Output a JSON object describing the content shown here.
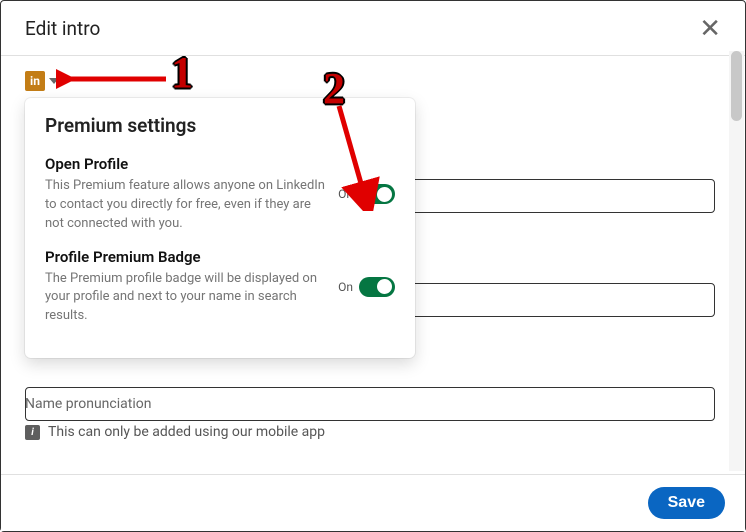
{
  "header": {
    "title": "Edit intro"
  },
  "badge": {
    "logo_text": "in"
  },
  "panel": {
    "title": "Premium settings",
    "settings": [
      {
        "title": "Open Profile",
        "desc": "This Premium feature allows anyone on LinkedIn to contact you directly for free, even if they are not connected with you.",
        "state": "On"
      },
      {
        "title": "Profile Premium Badge",
        "desc": "The Premium profile badge will be displayed on your profile and next to your name in search results.",
        "state": "On"
      }
    ]
  },
  "name_section": {
    "label": "Name pronunciation",
    "info_glyph": "i",
    "note": "This can only be added using our mobile app"
  },
  "footer": {
    "save": "Save"
  },
  "annotations": {
    "one": "1",
    "two": "2"
  }
}
